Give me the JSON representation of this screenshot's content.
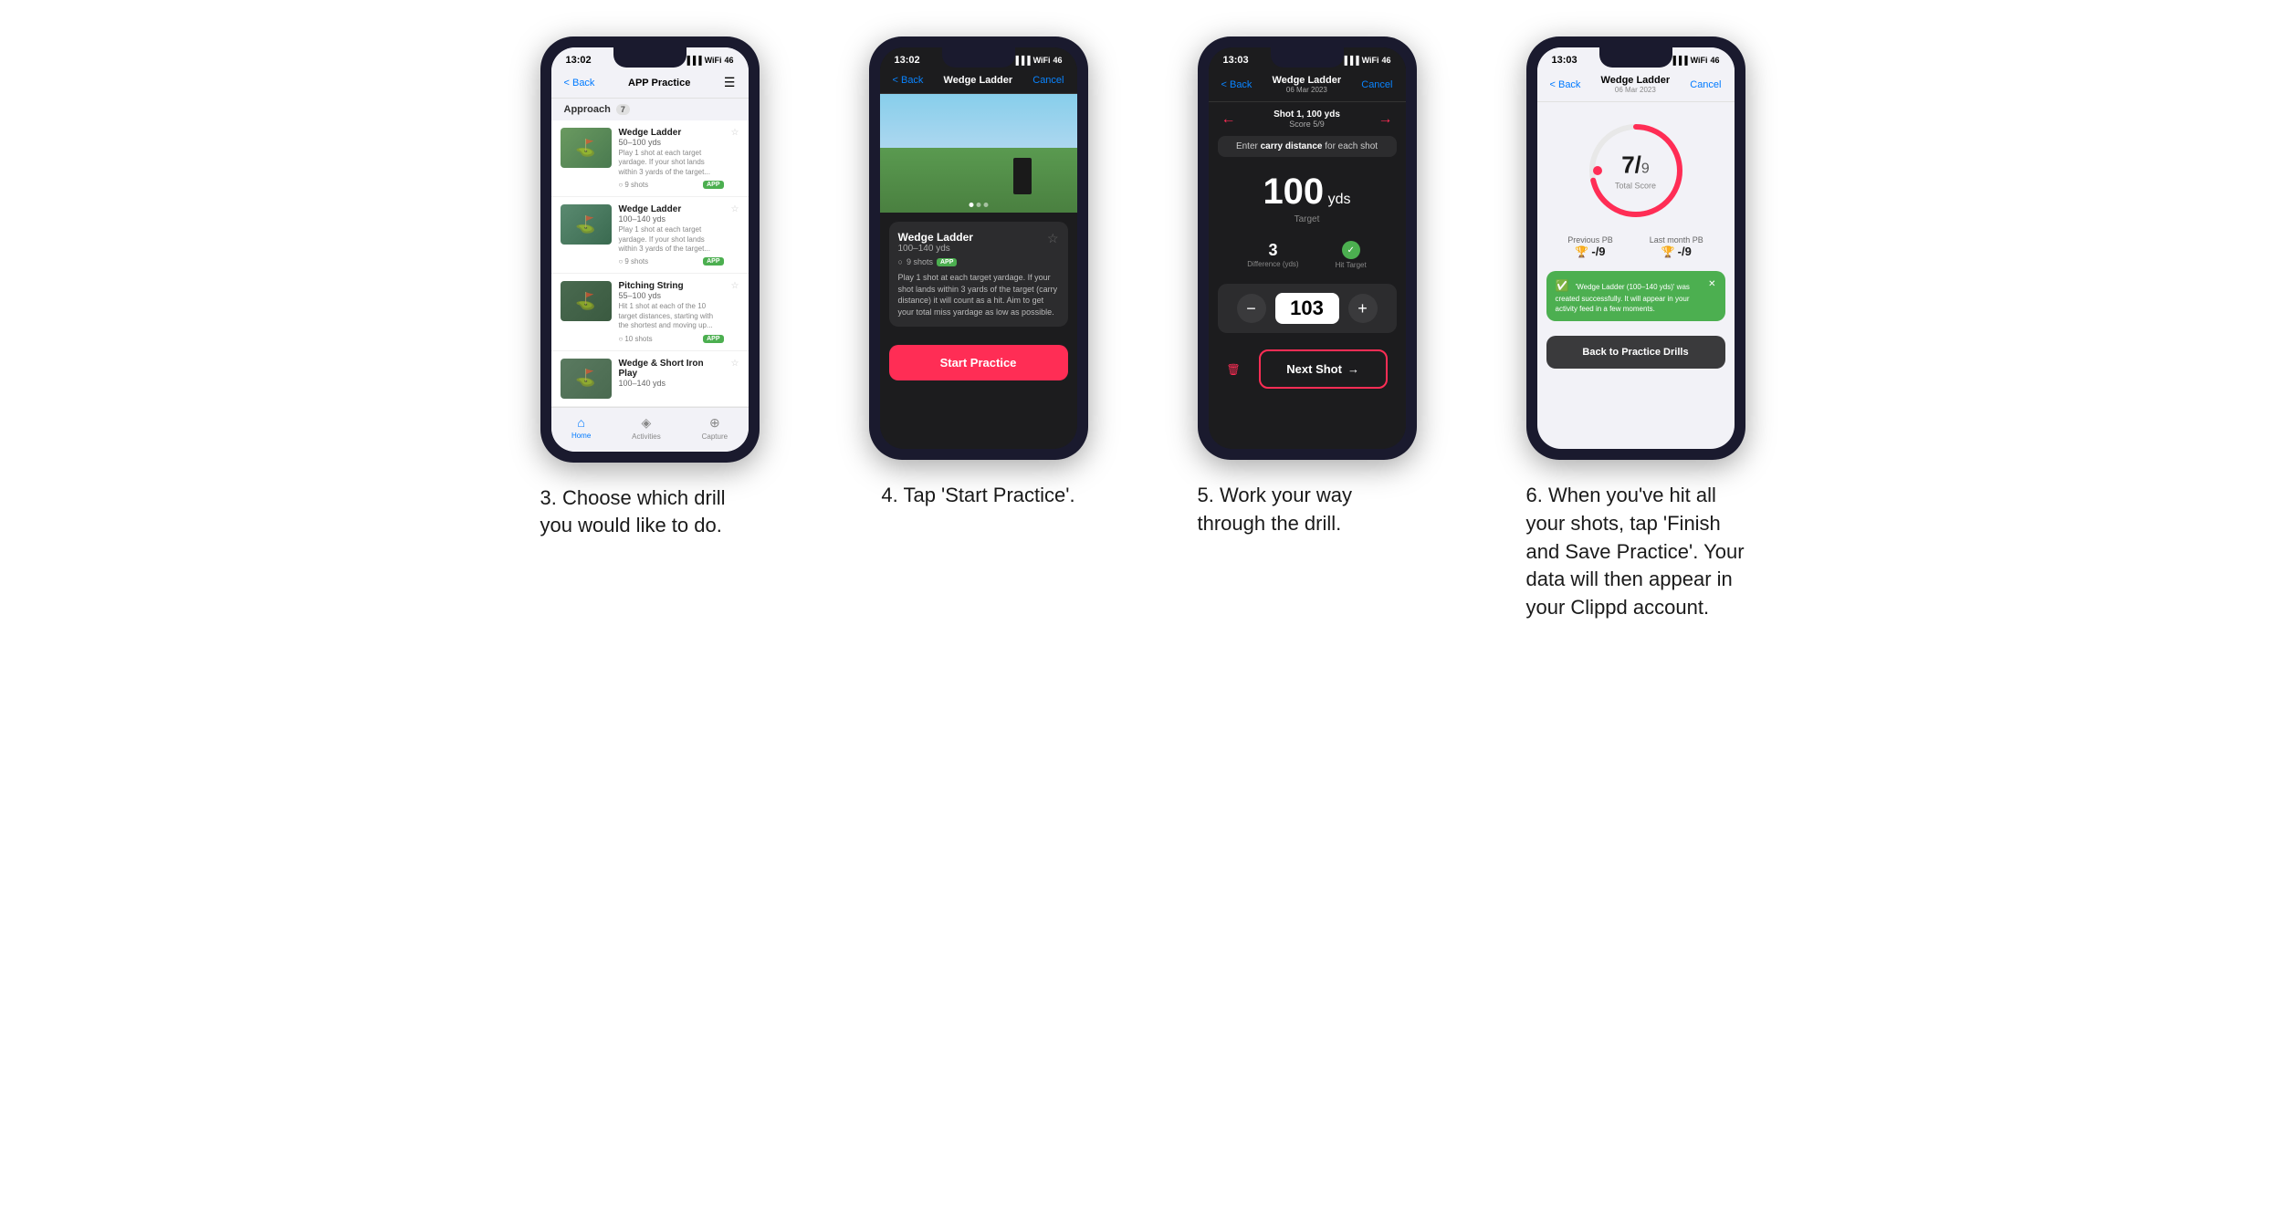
{
  "phones": [
    {
      "id": "phone1",
      "status_time": "13:02",
      "screen_type": "light",
      "nav": {
        "back_label": "< Back",
        "title": "APP Practice",
        "action": "☰"
      },
      "category": "Approach",
      "category_count": "7",
      "drills": [
        {
          "name": "Wedge Ladder",
          "yds": "50–100 yds",
          "desc": "Play 1 shot at each target yardage. If your shot lands within 3 yards of the target...",
          "shots": "9 shots",
          "badge": "APP",
          "thumb_class": "t1"
        },
        {
          "name": "Wedge Ladder",
          "yds": "100–140 yds",
          "desc": "Play 1 shot at each target yardage. If your shot lands within 3 yards of the target...",
          "shots": "9 shots",
          "badge": "APP",
          "thumb_class": "t2"
        },
        {
          "name": "Pitching String",
          "yds": "55–100 yds",
          "desc": "Hit 1 shot at each of the 10 target distances, starting with the shortest and moving up...",
          "shots": "10 shots",
          "badge": "APP",
          "thumb_class": "t3"
        },
        {
          "name": "Wedge & Short Iron Play",
          "yds": "100–140 yds",
          "desc": "",
          "shots": "",
          "badge": "",
          "thumb_class": "t4"
        }
      ],
      "tabs": [
        "Home",
        "Activities",
        "Capture"
      ]
    },
    {
      "id": "phone2",
      "status_time": "13:02",
      "screen_type": "dark",
      "nav": {
        "back_label": "< Back",
        "title": "Wedge Ladder",
        "action": "Cancel"
      },
      "drill": {
        "name": "Wedge Ladder",
        "yds": "100–140 yds",
        "shots": "9 shots",
        "badge": "APP",
        "desc": "Play 1 shot at each target yardage. If your shot lands within 3 yards of the target (carry distance) it will count as a hit. Aim to get your total miss yardage as low as possible."
      },
      "start_btn": "Start Practice"
    },
    {
      "id": "phone3",
      "status_time": "13:03",
      "screen_type": "dark",
      "nav": {
        "back_label": "< Back",
        "title": "Wedge Ladder",
        "subtitle": "06 Mar 2023",
        "action": "Cancel"
      },
      "shot": {
        "label": "Shot 1, 100 yds",
        "score": "Score 5/9"
      },
      "carry_instruction": "Enter carry distance for each shot",
      "target_yds": "100",
      "target_unit": "yds",
      "target_label": "Target",
      "difference": "3",
      "difference_label": "Difference (yds)",
      "hit_target_label": "Hit Target",
      "input_value": "103",
      "next_shot_label": "Next Shot"
    },
    {
      "id": "phone4",
      "status_time": "13:03",
      "screen_type": "light",
      "nav": {
        "back_label": "< Back",
        "title": "Wedge Ladder",
        "subtitle": "06 Mar 2023",
        "action": "Cancel"
      },
      "score": "7",
      "score_denom": "9",
      "score_label": "Total Score",
      "previous_pb_label": "Previous PB",
      "previous_pb_value": "-/9",
      "last_month_pb_label": "Last month PB",
      "last_month_pb_value": "-/9",
      "toast_msg": "'Wedge Ladder (100–140 yds)' was created successfully. It will appear in your activity feed in a few moments.",
      "back_btn_label": "Back to Practice Drills"
    }
  ],
  "captions": [
    "3. Choose which drill you would like to do.",
    "4. Tap 'Start Practice'.",
    "5. Work your way through the drill.",
    "6. When you've hit all your shots, tap 'Finish and Save Practice'. Your data will then appear in your Clippd account."
  ]
}
